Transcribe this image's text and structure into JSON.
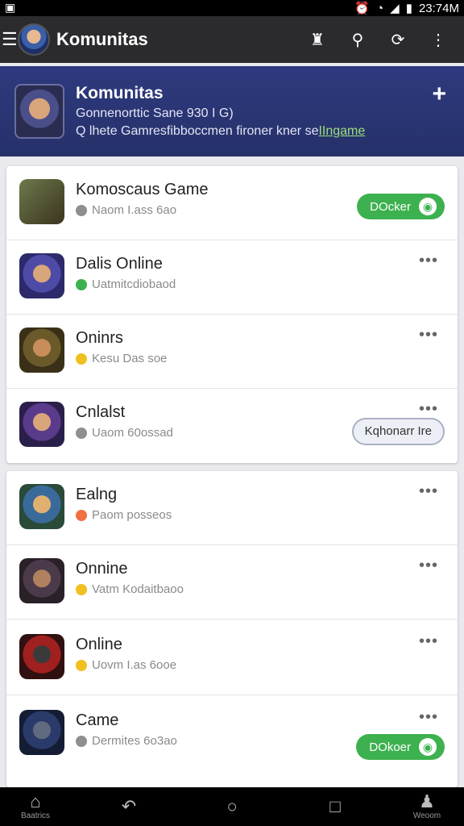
{
  "status_bar": {
    "time": "23:74M"
  },
  "app_bar": {
    "title": "Komunitas"
  },
  "hero": {
    "title": "Komunitas",
    "subtitle": "Gonnenorttic Sane  930 I G)",
    "description_prefix": "Q lhete Gamresfibboccmen fironer kner se",
    "description_link": "IIngame"
  },
  "card1": [
    {
      "title": "Komoscaus Game",
      "sub": "Naom I.ass 6ao",
      "dot": "#8f8f8f",
      "action": "green",
      "action_label": "DOcker"
    },
    {
      "title": "Dalis Online",
      "sub": "Uatmitcdiobaod",
      "dot": "#3db14f",
      "action": "more"
    },
    {
      "title": "Oninrs",
      "sub": "Kesu Das soe",
      "dot": "#f0c020",
      "action": "more"
    },
    {
      "title": "Cnlalst",
      "sub": "Uaom 60ossad",
      "dot": "#8f8f8f",
      "action": "outline",
      "action_label": "Kqhonarr Ire"
    }
  ],
  "card2": [
    {
      "title": "Ealng",
      "sub": "Paom posseos",
      "dot": "#f07040",
      "action": "more"
    },
    {
      "title": "Onnine",
      "sub": "Vatm Kodaitbaoo",
      "dot": "#f0c020",
      "action": "more"
    },
    {
      "title": "Online",
      "sub": "Uovm I.as 6ooe",
      "dot": "#f0c020",
      "action": "more"
    },
    {
      "title": "Came",
      "sub": "Dermites 6o3ao",
      "dot": "#8f8f8f",
      "action": "green",
      "action_label": "DOkoer"
    }
  ],
  "bottom_nav": {
    "home_label": "Baatrics",
    "profile_label": "Weoom"
  },
  "colors": {
    "accent_green": "#3db14f",
    "hero_bg": "#2e3a7e"
  }
}
